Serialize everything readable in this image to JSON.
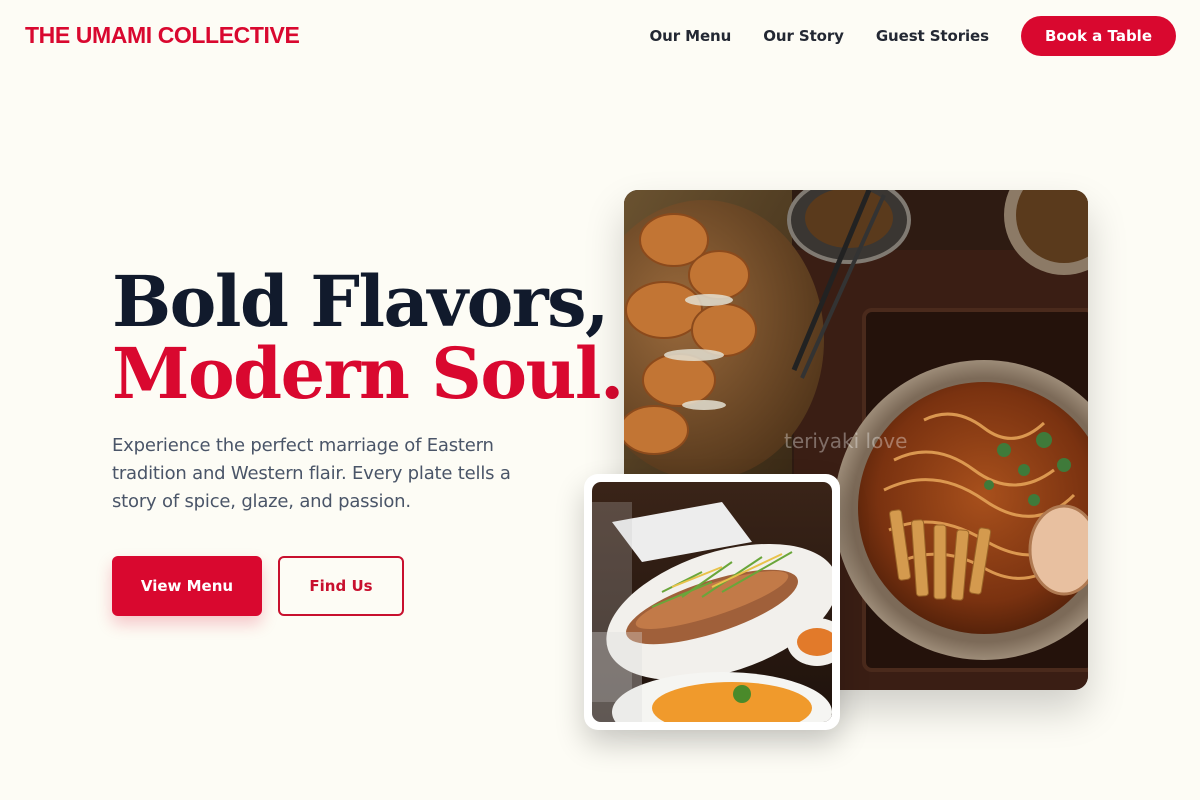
{
  "brand": {
    "name": "THE UMAMI COLLECTIVE"
  },
  "nav": {
    "links": [
      "Our Menu",
      "Our Story",
      "Guest Stories"
    ],
    "cta": "Book a Table"
  },
  "hero": {
    "title_line1": "Bold Flavors,",
    "title_line2": "Modern Soul.",
    "description": "Experience the perfect marriage of Eastern tradition and Western flair. Every plate tells a story of spice, glaze, and passion.",
    "primary_button": "View Menu",
    "secondary_button": "Find Us",
    "main_image_alt": "Ramen bowl with karaage chicken and chopsticks",
    "main_image_watermark": "teriyaki love",
    "side_image_alt": "Grilled fish topped with herbs on a restaurant table"
  },
  "colors": {
    "accent": "#d9082f",
    "background": "#fdfcf5",
    "heading": "#111a2c",
    "body_text": "#4a5568"
  }
}
